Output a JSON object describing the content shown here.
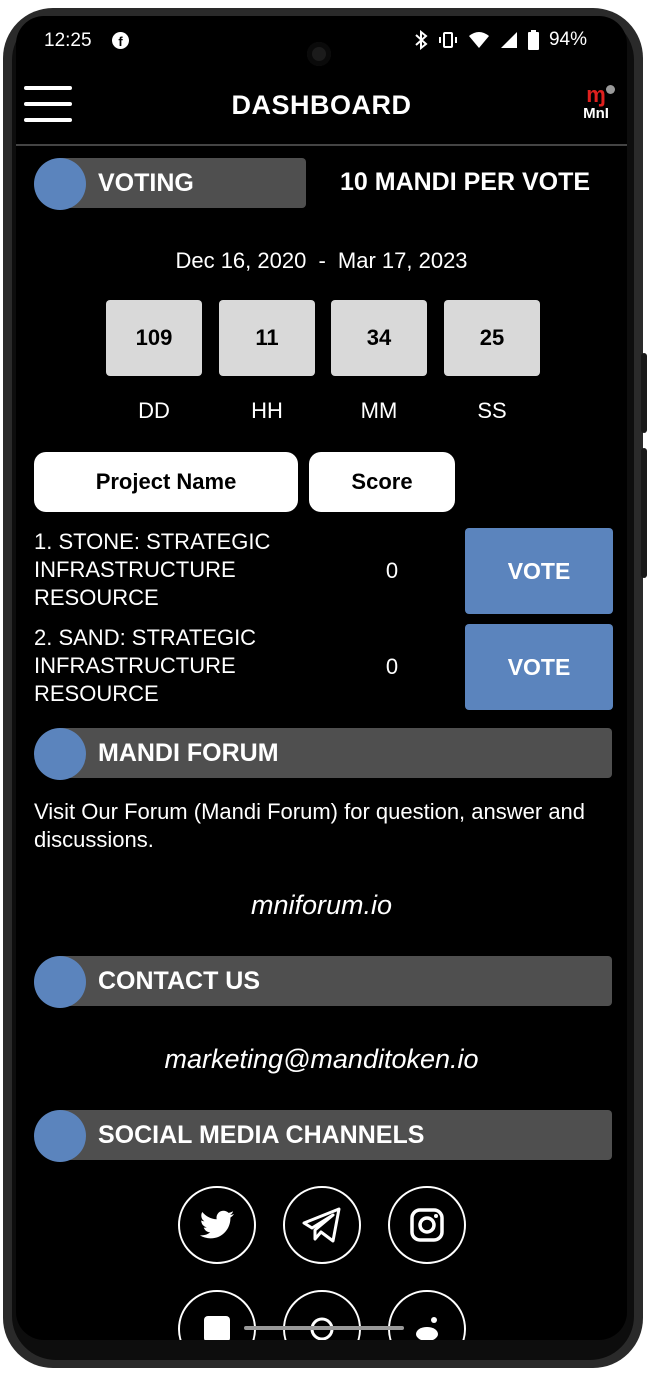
{
  "status_bar": {
    "time": "12:25",
    "battery": "94%"
  },
  "header": {
    "title": "DASHBOARD",
    "logo_text": "MnI"
  },
  "voting": {
    "section_label": "VOTING",
    "per_vote": "10 MANDI PER VOTE",
    "start_date": "Dec 16, 2020",
    "separator": "-",
    "end_date": "Mar 17, 2023",
    "countdown": [
      {
        "value": "109",
        "unit": "DD"
      },
      {
        "value": "11",
        "unit": "HH"
      },
      {
        "value": "34",
        "unit": "MM"
      },
      {
        "value": "25",
        "unit": "SS"
      }
    ],
    "columns": {
      "project": "Project Name",
      "score": "Score"
    },
    "projects": [
      {
        "name": "1. STONE: STRATEGIC INFRASTRUCTURE RESOURCE",
        "score": "0",
        "vote_label": "VOTE"
      },
      {
        "name": "2. SAND: STRATEGIC INFRASTRUCTURE RESOURCE",
        "score": "0",
        "vote_label": "VOTE"
      }
    ]
  },
  "forum": {
    "section_label": "MANDI FORUM",
    "description": "Visit Our Forum (Mandi Forum) for question, answer and discussions.",
    "link": "mniforum.io"
  },
  "contact": {
    "section_label": "CONTACT US",
    "email": "marketing@manditoken.io"
  },
  "social": {
    "section_label": "SOCIAL MEDIA CHANNELS",
    "icons": [
      "twitter-icon",
      "telegram-icon",
      "instagram-icon",
      "facebook-icon",
      "medium-icon",
      "reddit-icon"
    ]
  },
  "colors": {
    "accent": "#5b84bd",
    "section_bar": "#4f4f4f",
    "logo_red": "#e0201e"
  }
}
